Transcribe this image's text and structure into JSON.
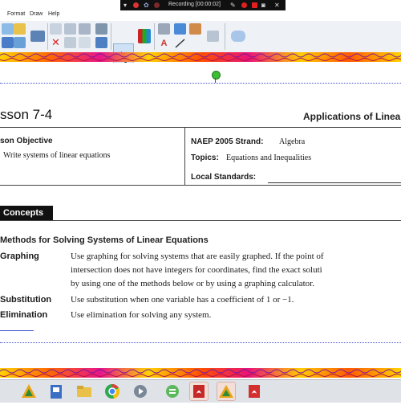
{
  "menubar": {
    "items": [
      "Format",
      "Draw",
      "Help"
    ]
  },
  "recording": {
    "label": "Recording [00:00:02]"
  },
  "document": {
    "lesson_title": "sson 7-4",
    "section_title": "Applications of Linea",
    "objective_heading": "son Objective",
    "objective_text": "Write systems of linear equations",
    "naep_label": "NAEP 2005 Strand:",
    "naep_value": "Algebra",
    "topics_label": "Topics:",
    "topics_value": "Equations and Inequalities",
    "local_standards_label": "Local Standards:",
    "concepts_tab": "Concepts",
    "methods_heading": "Methods for Solving Systems of Linear Equations",
    "methods": [
      {
        "name": "Graphing",
        "lines": [
          "Use graphing for solving systems that are easily graphed. If the point of",
          "intersection does not have integers for coordinates, find the exact soluti",
          "by using one of the methods below or by using a graphing calculator."
        ]
      },
      {
        "name": "Substitution",
        "lines": [
          "Use substitution when one variable has a coefficient of 1 or −1."
        ]
      },
      {
        "name": "Elimination",
        "lines": [
          "Use elimination for solving any system."
        ]
      }
    ]
  },
  "icons": {
    "toolbar": [
      "new-file-icon",
      "open-folder-icon",
      "save-icon",
      "display-icon",
      "copy-icon",
      "paste-icon",
      "cut-icon",
      "delete-icon",
      "insert-page-icon",
      "table-icon",
      "web-icon",
      "close-page-icon",
      "select-arrow-icon",
      "pens-icon",
      "eraser-icon",
      "highlighter-icon",
      "text-icon",
      "line-icon",
      "clear-icon",
      "capture-icon"
    ],
    "taskbar": [
      "smart-notebook-icon",
      "notebook-icon",
      "file-explorer-icon",
      "chrome-icon",
      "media-player-icon",
      "green-app-icon",
      "pdf-reader-icon",
      "smart-notebook-icon-2",
      "pdf-reader-icon-2"
    ]
  },
  "colors": {
    "accent_blue": "#3a6fc4",
    "record_red": "#e02020",
    "handle_green": "#3bbd34",
    "concepts_tab_bg": "#111111"
  }
}
